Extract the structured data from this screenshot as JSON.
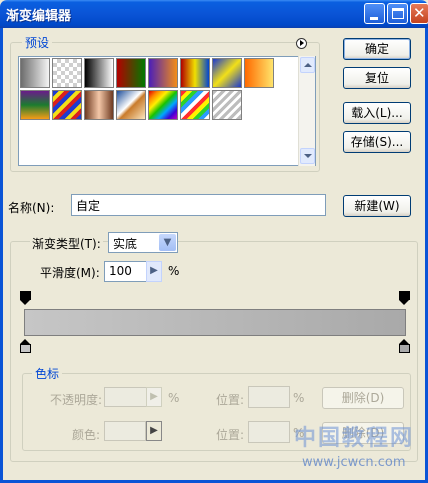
{
  "window": {
    "title": "渐变编辑器"
  },
  "presets": {
    "label": "预设",
    "swatches_row1": [
      "gray-white",
      "transparent-checker",
      "black-white",
      "red-green",
      "purple-orange",
      "red-yellow-blue",
      "blue-yellow-blue",
      "orange-yellow"
    ],
    "swatches_row2": [
      "purple-green-orange",
      "spectrum-stripes",
      "copper",
      "chrome",
      "spectrum",
      "transparent-rainbow",
      "transparent-stripes"
    ]
  },
  "buttons": {
    "ok": "确定",
    "reset": "复位",
    "load": "载入(L)...",
    "save": "存储(S)...",
    "new": "新建(W)"
  },
  "name": {
    "label": "名称(N):",
    "value": "自定"
  },
  "gradient": {
    "type_label": "渐变类型(T):",
    "type_value": "实底",
    "smoothness_label": "平滑度(M):",
    "smoothness_value": "100",
    "smoothness_unit": "%"
  },
  "stops": {
    "label": "色标",
    "opacity_label": "不透明度:",
    "opacity_unit": "%",
    "position_label_1": "位置:",
    "position_unit_1": "%",
    "delete_1": "删除(D)",
    "color_label": "颜色:",
    "position_label_2": "位置:",
    "position_unit_2": "%",
    "delete_2": "删除(D)"
  },
  "colors": {
    "title_bar": "#0a54d6",
    "background": "#ece9d8",
    "group_label": "#0046d5"
  },
  "watermark": {
    "text": "中国教程网",
    "url": "www.jcwcn.com"
  }
}
